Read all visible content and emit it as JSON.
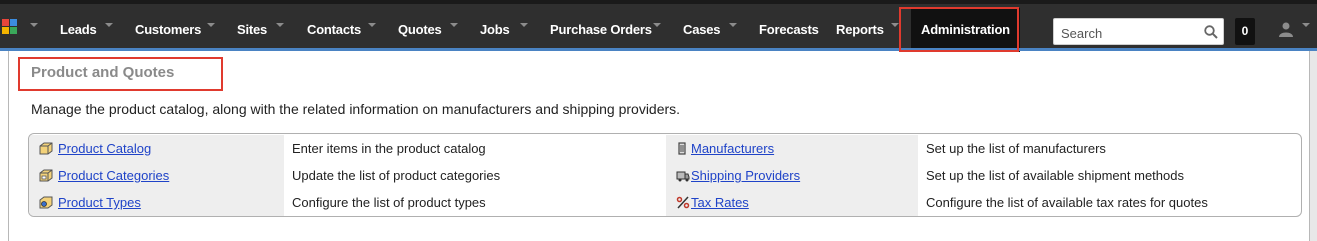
{
  "nav": {
    "items": [
      {
        "label": "Leads"
      },
      {
        "label": "Customers"
      },
      {
        "label": "Sites"
      },
      {
        "label": "Contacts"
      },
      {
        "label": "Quotes"
      },
      {
        "label": "Jobs"
      },
      {
        "label": "Purchase Orders"
      },
      {
        "label": "Cases"
      },
      {
        "label": "Forecasts"
      },
      {
        "label": "Reports"
      },
      {
        "label": "Administration"
      }
    ],
    "search_placeholder": "Search",
    "notification_count": "0"
  },
  "panel": {
    "title": "Product and Quotes",
    "description": "Manage the product catalog, along with the related information on manufacturers and shipping providers.",
    "rows": [
      {
        "left_link": "Product Catalog",
        "left_desc": "Enter items in the product catalog",
        "right_link": "Manufacturers",
        "right_desc": "Set up the list of manufacturers"
      },
      {
        "left_link": "Product Categories",
        "left_desc": "Update the list of product categories",
        "right_link": "Shipping Providers",
        "right_desc": "Set up the list of available shipment methods"
      },
      {
        "left_link": "Product Types",
        "left_desc": "Configure the list of product types",
        "right_link": "Tax Rates",
        "right_desc": "Configure the list of available tax rates for quotes"
      }
    ]
  },
  "colors": {
    "topbar": "#2f2f2f",
    "accent": "#4a83c3",
    "highlight": "#e03a2e",
    "link": "#1f43c8"
  }
}
